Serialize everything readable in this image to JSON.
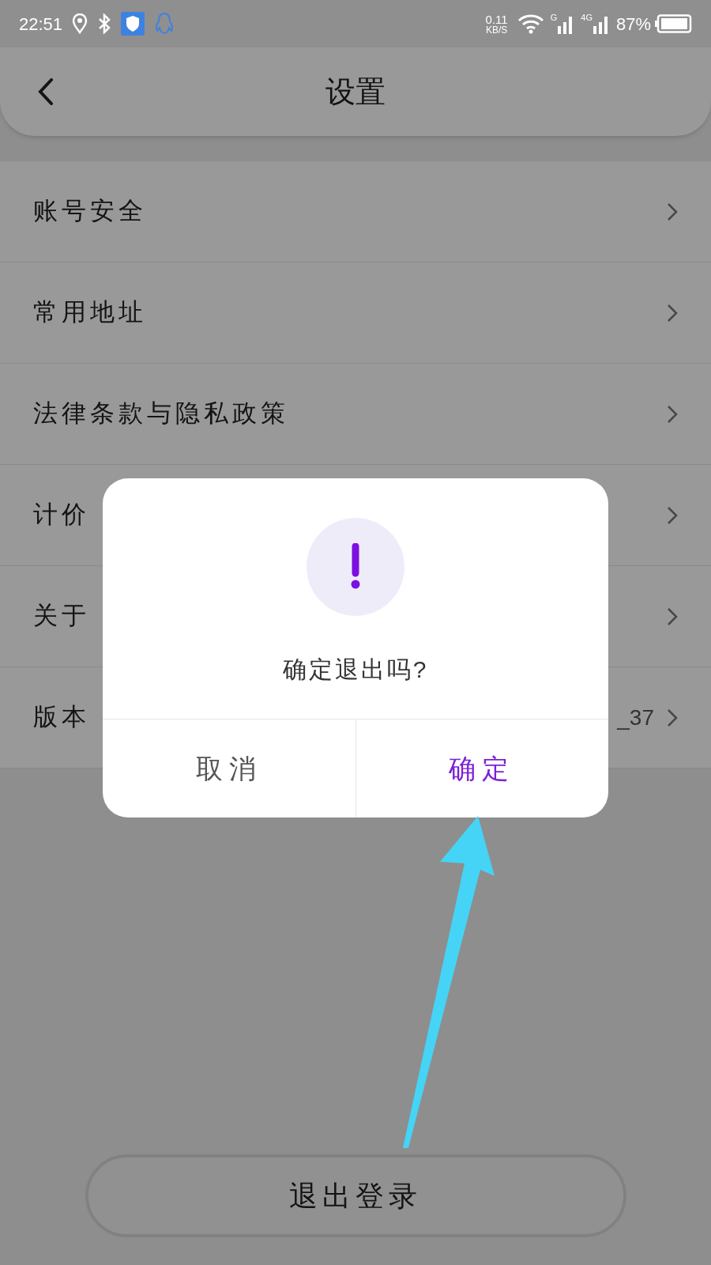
{
  "status_bar": {
    "time": "22:51",
    "speed": "0.11",
    "speed_unit": "KB/S",
    "network_1": "G",
    "network_2": "4G",
    "battery": "87%"
  },
  "header": {
    "title": "设置"
  },
  "settings": [
    {
      "label": "账号安全"
    },
    {
      "label": "常用地址"
    },
    {
      "label": "法律条款与隐私政策"
    },
    {
      "label": "计价"
    },
    {
      "label": "关于"
    },
    {
      "label": "版本",
      "value": "_37"
    }
  ],
  "dialog": {
    "message": "确定退出吗?",
    "buttons": [
      {
        "label": "取消",
        "kind": "cancel"
      },
      {
        "label": "确定",
        "kind": "confirm"
      }
    ]
  },
  "logout_button": "退出登录"
}
